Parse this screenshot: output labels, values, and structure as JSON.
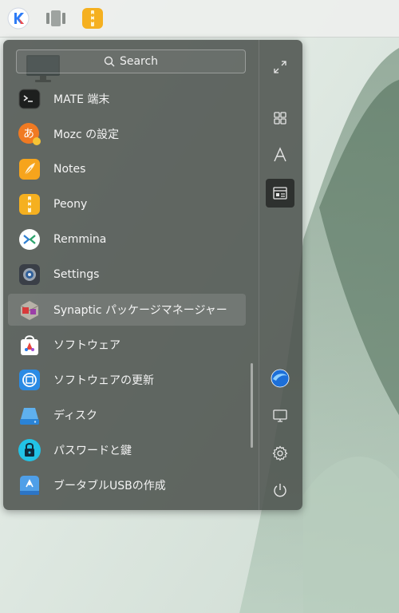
{
  "search": {
    "label": "Search"
  },
  "apps": [
    {
      "label": "MATE 端末",
      "icon": "terminal-icon"
    },
    {
      "label": "Mozc の設定",
      "icon": "mozc-icon"
    },
    {
      "label": "Notes",
      "icon": "notes-icon"
    },
    {
      "label": "Peony",
      "icon": "peony-icon"
    },
    {
      "label": "Remmina",
      "icon": "remmina-icon"
    },
    {
      "label": "Settings",
      "icon": "settings-icon"
    },
    {
      "label": "Synaptic パッケージマネージャー",
      "icon": "synaptic-icon"
    },
    {
      "label": "ソフトウェア",
      "icon": "software-icon"
    },
    {
      "label": "ソフトウェアの更新",
      "icon": "software-update-icon"
    },
    {
      "label": "ディスク",
      "icon": "disk-icon"
    },
    {
      "label": "パスワードと鍵",
      "icon": "password-lock-icon"
    },
    {
      "label": "ブータブルUSBの作成",
      "icon": "usb-creator-icon"
    }
  ],
  "sidebar": [
    "expand-icon",
    "grid-icon",
    "letter-a-icon",
    "category-icon",
    "browser-icon",
    "computer-icon",
    "gear-icon",
    "power-icon"
  ],
  "colors": {
    "accent": "#f5a623",
    "menu_bg": "#4a504c",
    "text": "#f4f4f4"
  }
}
